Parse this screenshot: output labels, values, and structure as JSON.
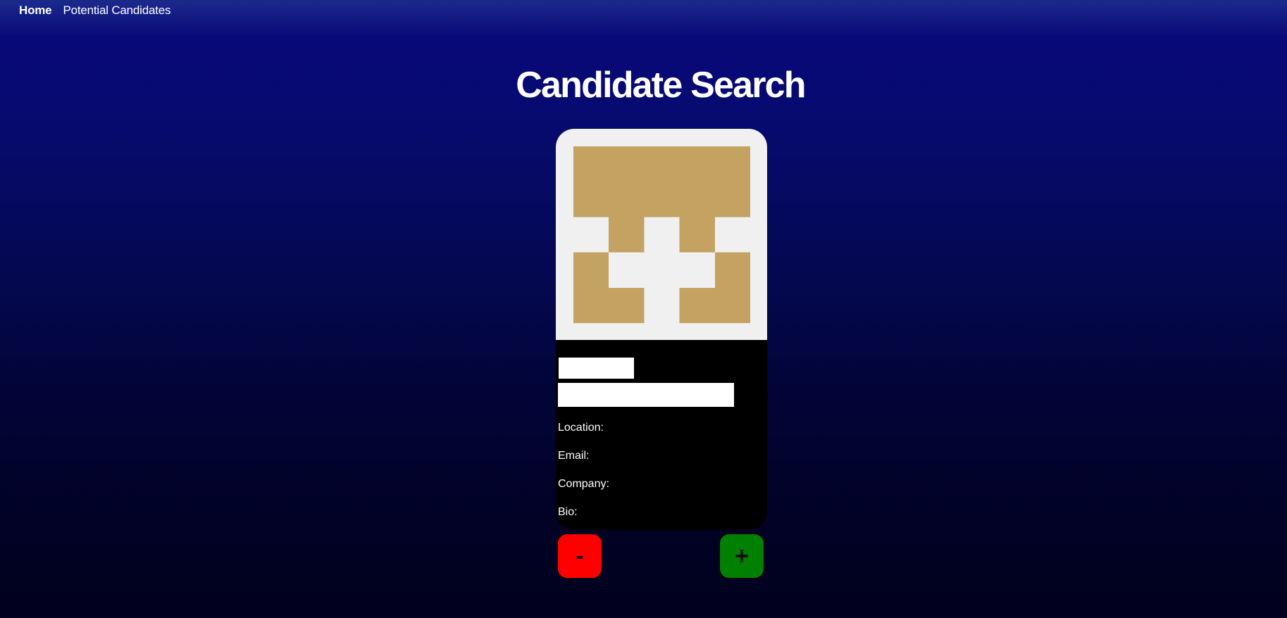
{
  "nav": {
    "home": "Home",
    "potential_candidates": "Potential Candidates"
  },
  "page": {
    "title": "Candidate Search"
  },
  "candidate": {
    "avatar": "identicon",
    "avatar_color": "#c4a262",
    "avatar_bg": "#f0f0f0",
    "fields": {
      "location": "Location:",
      "email": "Email:",
      "company": "Company:",
      "bio": "Bio:"
    }
  },
  "actions": {
    "reject": "-",
    "accept": "+",
    "reject_color": "#ff0000",
    "accept_color": "#008000"
  }
}
